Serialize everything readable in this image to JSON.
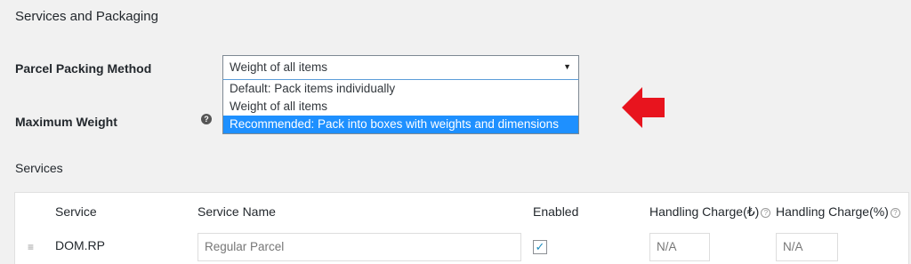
{
  "section": {
    "title": "Services and Packaging"
  },
  "packing": {
    "label": "Parcel Packing Method",
    "selected_value": "Weight of all items",
    "options": [
      "Default: Pack items individually",
      "Weight of all items",
      "Recommended: Pack into boxes with weights and dimensions"
    ],
    "highlighted_index": 2
  },
  "max_weight": {
    "label": "Maximum Weight",
    "help_glyph": "?"
  },
  "services": {
    "label": "Services",
    "columns": {
      "service": "Service",
      "service_name": "Service Name",
      "enabled": "Enabled",
      "handling_charge_currency": "Handling Charge(₺)",
      "handling_charge_percent": "Handling Charge(%)"
    },
    "rows": [
      {
        "service": "DOM.RP",
        "service_name_placeholder": "Regular Parcel",
        "enabled": true,
        "handling_charge_currency_placeholder": "N/A",
        "handling_charge_percent_placeholder": "N/A"
      }
    ]
  },
  "colors": {
    "highlight": "#1e90ff",
    "arrow": "#e8141e",
    "background": "#f1f1f1"
  }
}
